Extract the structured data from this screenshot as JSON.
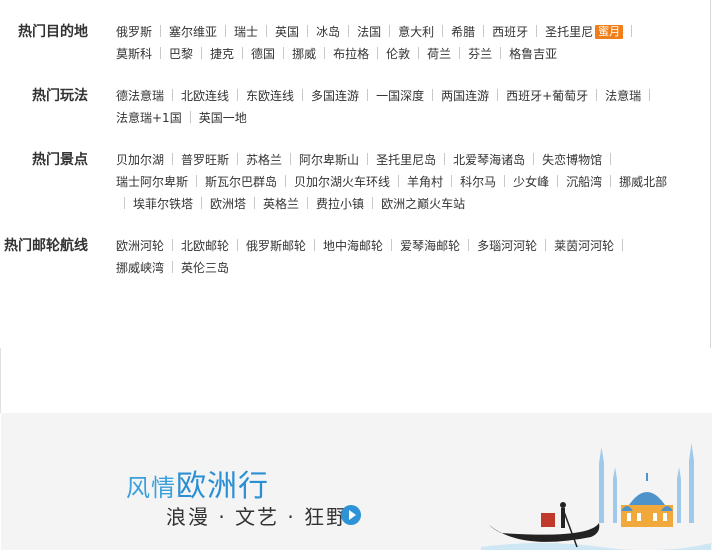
{
  "sections": [
    {
      "title": "热门目的地",
      "items": [
        {
          "label": "俄罗斯"
        },
        {
          "label": "塞尔维亚"
        },
        {
          "label": "瑞士"
        },
        {
          "label": "英国"
        },
        {
          "label": "冰岛"
        },
        {
          "label": "法国"
        },
        {
          "label": "意大利"
        },
        {
          "label": "希腊"
        },
        {
          "label": "西班牙"
        },
        {
          "label": "圣托里尼",
          "badge": "蜜月"
        },
        {
          "label": "莫斯科"
        },
        {
          "label": "巴黎"
        },
        {
          "label": "捷克"
        },
        {
          "label": "德国"
        },
        {
          "label": "挪威"
        },
        {
          "label": "布拉格"
        },
        {
          "label": "伦敦"
        },
        {
          "label": "荷兰"
        },
        {
          "label": "芬兰"
        },
        {
          "label": "格鲁吉亚"
        }
      ]
    },
    {
      "title": "热门玩法",
      "items": [
        {
          "label": "德法意瑞"
        },
        {
          "label": "北欧连线"
        },
        {
          "label": "东欧连线"
        },
        {
          "label": "多国连游"
        },
        {
          "label": "一国深度"
        },
        {
          "label": "两国连游"
        },
        {
          "label": "西班牙+葡萄牙"
        },
        {
          "label": "法意瑞"
        },
        {
          "label": "法意瑞+1国"
        },
        {
          "label": "英国一地"
        }
      ]
    },
    {
      "title": "热门景点",
      "items": [
        {
          "label": "贝加尔湖"
        },
        {
          "label": "普罗旺斯"
        },
        {
          "label": "苏格兰"
        },
        {
          "label": "阿尔卑斯山"
        },
        {
          "label": "圣托里尼岛"
        },
        {
          "label": "北爱琴海诸岛"
        },
        {
          "label": "失恋博物馆"
        },
        {
          "label": "瑞士阿尔卑斯"
        },
        {
          "label": "斯瓦尔巴群岛"
        },
        {
          "label": "贝加尔湖火车环线"
        },
        {
          "label": "羊角村"
        },
        {
          "label": "科尔马"
        },
        {
          "label": "少女峰"
        },
        {
          "label": "沉船湾"
        },
        {
          "label": "挪威北部"
        },
        {
          "label": "埃菲尔铁塔"
        },
        {
          "label": "欧洲塔"
        },
        {
          "label": "英格兰"
        },
        {
          "label": "费拉小镇"
        },
        {
          "label": "欧洲之巅火车站"
        }
      ]
    },
    {
      "title": "热门邮轮航线",
      "items": [
        {
          "label": "欧洲河轮"
        },
        {
          "label": "北欧邮轮"
        },
        {
          "label": "俄罗斯邮轮"
        },
        {
          "label": "地中海邮轮"
        },
        {
          "label": "爱琴海邮轮"
        },
        {
          "label": "多瑙河河轮"
        },
        {
          "label": "莱茵河河轮"
        },
        {
          "label": "挪威峡湾"
        },
        {
          "label": "英伦三岛"
        }
      ]
    }
  ],
  "banner": {
    "title_part1": "风情",
    "title_part2": "欧洲行",
    "subtitle": "浪漫 · 文艺 · 狂野"
  },
  "colors": {
    "badge": "#f07f1b",
    "banner_blue": "#2b8fd4",
    "banner_bg": "#f4f4f4"
  }
}
